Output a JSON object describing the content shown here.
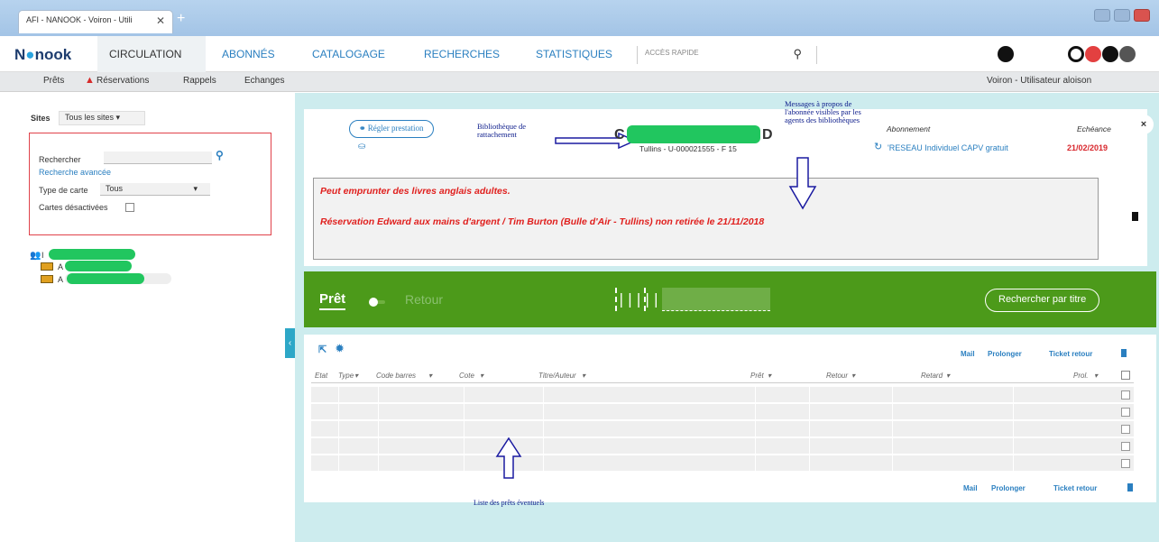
{
  "browser": {
    "tab_title": "AFI - NANOOK - Voiron - Utili",
    "tab_close": "✕",
    "new_tab": "+"
  },
  "app": {
    "logo_prefix": "N",
    "logo_suffix": "nook",
    "nav": [
      "CIRCULATION",
      "ABONNÉS",
      "CATALOGAGE",
      "RECHERCHES",
      "STATISTIQUES"
    ],
    "quick_access_placeholder": "ACCÈS RAPIDE",
    "user_label": "Voiron - Utilisateur aloison"
  },
  "subnav": {
    "items": [
      "Prêts",
      "Réservations",
      "Rappels",
      "Echanges"
    ]
  },
  "sidebar": {
    "sites_label": "Sites",
    "sites_value": "Tous les sites",
    "search_label": "Rechercher",
    "advanced_search": "Recherche avancée",
    "card_type_label": "Type de carte",
    "card_type_value": "Tous",
    "disabled_cards_label": "Cartes désactivées",
    "results": [
      "I",
      "A",
      "A"
    ]
  },
  "patron": {
    "settle_button": "Régler prestation",
    "name_start": "C",
    "name_end": "D",
    "library_info": "Tullins - U-000021555 - F 15",
    "subscription_label": "Abonnement",
    "subscription_value": "'RESEAU Individuel CAPV gratuit",
    "due_label": "Echéance",
    "due_value": "21/02/2019",
    "close": "×"
  },
  "messages": [
    "Peut emprunter des livres anglais adultes.",
    "Réservation Edward aux mains d'argent / Tim Burton (Bulle d'Air - Tullins) non retirée le 21/11/2018"
  ],
  "annotations": {
    "library": "Bibliothèque de rattachement",
    "messages": "Messages à propos de l'abonnée visibles par les agents des bibliothèques",
    "loans": "Liste des prêts éventuels"
  },
  "circulation": {
    "mode_active": "Prêt",
    "mode_other": "Retour",
    "search_title": "Rechercher par titre"
  },
  "loans_table": {
    "actions": [
      "Mail",
      "Prolonger",
      "Ticket retour"
    ],
    "columns": [
      "Etat",
      "Type",
      "Code barres",
      "Cote",
      "Titre/Auteur",
      "Prêt",
      "Retour",
      "Retard",
      "Prol."
    ],
    "row_count": 5
  },
  "colors": {
    "accent": "#2a7fc0",
    "alert": "#e0201e",
    "green_bar": "#4c9a1a",
    "main_bg": "#cdecee"
  }
}
